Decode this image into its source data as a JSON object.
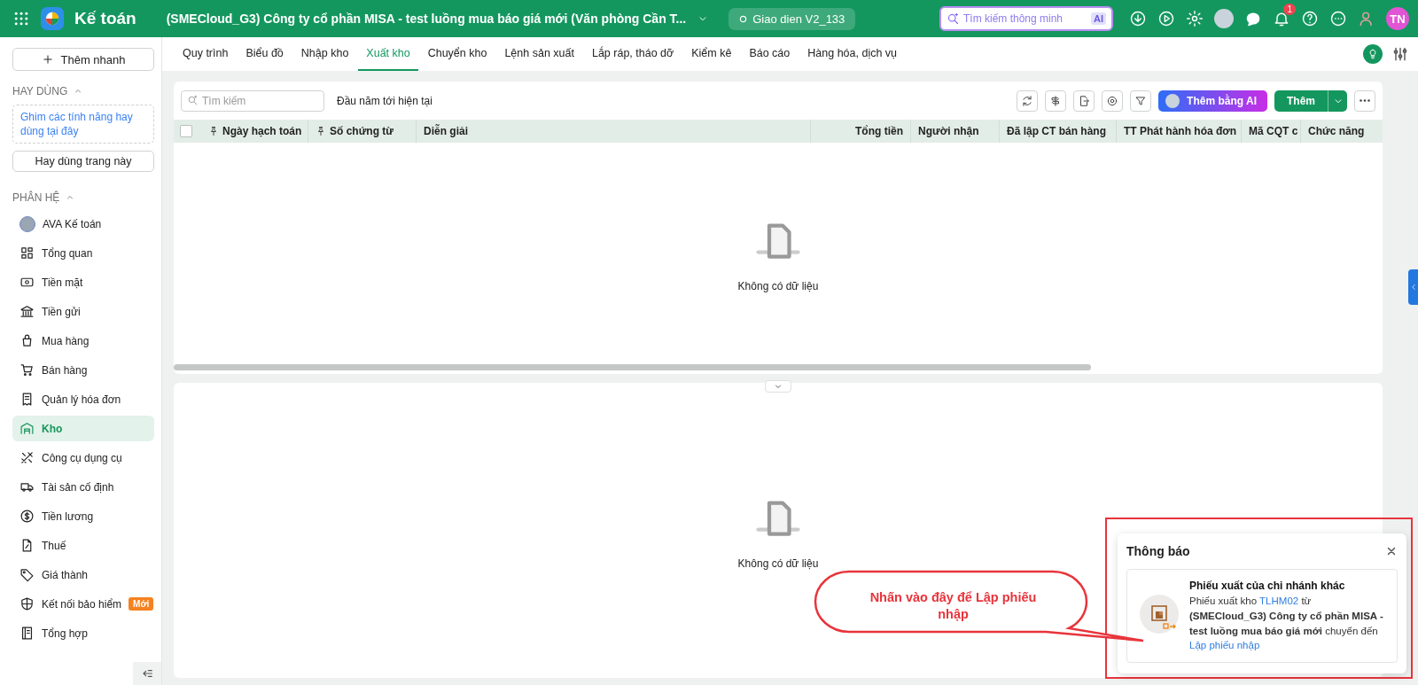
{
  "app": {
    "title": "Kế toán",
    "company": "(SMECloud_G3) Công ty cổ phần MISA - test luồng mua báo giá mới (Văn phòng Cần T...",
    "version": "Giao dien V2_133"
  },
  "topbar": {
    "search_placeholder": "Tìm kiếm thông minh",
    "ai_badge": "AI",
    "notification_count": "1",
    "user_initials": "TN"
  },
  "sidebar": {
    "quick_add": "Thêm nhanh",
    "favorites_title": "HAY DÙNG",
    "favorites_hint": "Ghim các tính năng hay dùng tại đây",
    "favorites_button": "Hay dùng trang này",
    "modules_title": "PHÂN HỆ",
    "items": [
      {
        "label": "AVA Kế toán",
        "kind": "avatar",
        "selected": false
      },
      {
        "label": "Tổng quan",
        "kind": "grid",
        "selected": false
      },
      {
        "label": "Tiền mặt",
        "kind": "cash",
        "selected": false
      },
      {
        "label": "Tiền gửi",
        "kind": "bank",
        "selected": false
      },
      {
        "label": "Mua hàng",
        "kind": "bag",
        "selected": false
      },
      {
        "label": "Bán hàng",
        "kind": "cart",
        "selected": false
      },
      {
        "label": "Quản lý hóa đơn",
        "kind": "receipt",
        "selected": false
      },
      {
        "label": "Kho",
        "kind": "warehouse",
        "selected": true
      },
      {
        "label": "Công cụ dụng cụ",
        "kind": "tools",
        "selected": false
      },
      {
        "label": "Tài sản cố định",
        "kind": "truck",
        "selected": false
      },
      {
        "label": "Tiền lương",
        "kind": "dollar",
        "selected": false
      },
      {
        "label": "Thuế",
        "kind": "tax",
        "selected": false
      },
      {
        "label": "Giá thành",
        "kind": "tag",
        "selected": false
      },
      {
        "label": "Kết nối bảo hiểm",
        "kind": "shield",
        "selected": false,
        "badge": "Mới"
      },
      {
        "label": "Tổng hợp",
        "kind": "book",
        "selected": false
      }
    ]
  },
  "tabs": [
    {
      "label": "Quy trình",
      "selected": false
    },
    {
      "label": "Biểu đồ",
      "selected": false
    },
    {
      "label": "Nhập kho",
      "selected": false
    },
    {
      "label": "Xuất kho",
      "selected": true
    },
    {
      "label": "Chuyển kho",
      "selected": false
    },
    {
      "label": "Lệnh sản xuất",
      "selected": false
    },
    {
      "label": "Lắp ráp, tháo dỡ",
      "selected": false
    },
    {
      "label": "Kiểm kê",
      "selected": false
    },
    {
      "label": "Báo cáo",
      "selected": false
    },
    {
      "label": "Hàng hóa, dịch vụ",
      "selected": false
    }
  ],
  "toolbar": {
    "search_placeholder": "Tìm kiếm",
    "period": "Đầu năm tới hiện tại",
    "ai_button": "Thêm bằng AI",
    "add_button": "Thêm"
  },
  "table": {
    "select_all_checked": false,
    "columns": [
      {
        "label": "Ngày hạch toán",
        "pinned": true
      },
      {
        "label": "Số chứng từ",
        "pinned": true
      },
      {
        "label": "Diễn giải",
        "pinned": false
      },
      {
        "label": "Tổng tiền",
        "pinned": false
      },
      {
        "label": "Người nhận",
        "pinned": false
      },
      {
        "label": "Đã lập CT bán hàng",
        "pinned": false
      },
      {
        "label": "TT Phát hành hóa đơn",
        "pinned": false
      },
      {
        "label": "Mã CQT c",
        "pinned": false
      },
      {
        "label": "Chức năng",
        "pinned": false
      }
    ],
    "empty_text": "Không có dữ liệu"
  },
  "detail": {
    "empty_text": "Không có dữ liệu"
  },
  "notification": {
    "title": "Thông báo",
    "heading": "Phiếu xuất của chi nhánh khác",
    "body_start": "Phiếu xuất kho",
    "code": "TLHM02",
    "body_end": "từ **(SMECloud_G3) Công ty cổ phần MISA - test luồng mua báo giá mới** chuyển đến",
    "action": "Lập phiếu nhập"
  },
  "annotation": {
    "text": "Nhấn vào đây để Lập phiếu nhập"
  }
}
